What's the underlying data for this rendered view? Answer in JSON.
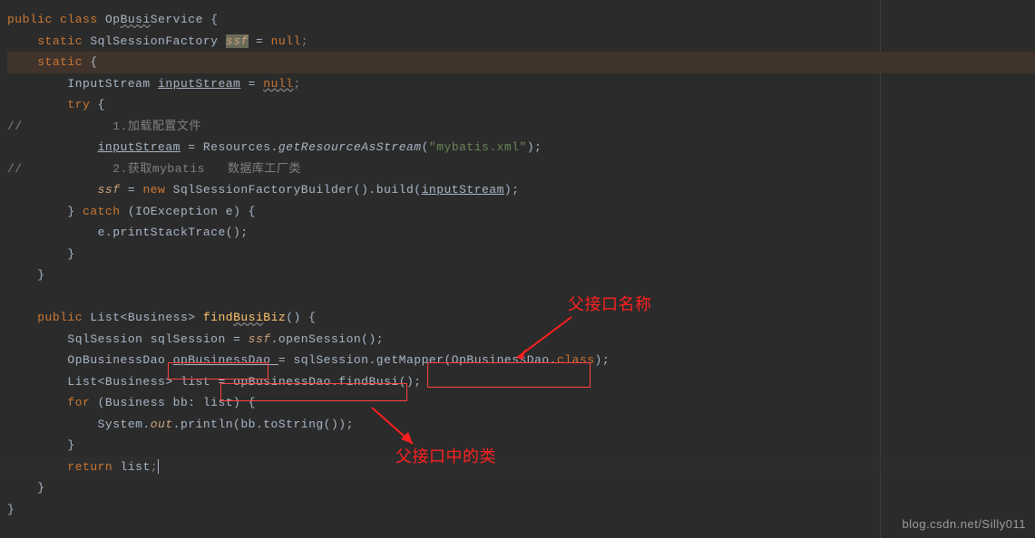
{
  "code": {
    "l1_public": "public",
    "l1_class": "class",
    "l1_name1": "Op",
    "l1_name2": "Busi",
    "l1_name3": "Service",
    "l1_brace": " {",
    "l2_static": "static",
    "l2_type": " SqlSessionFactory ",
    "l2_var": "ssf",
    "l2_eq": " = ",
    "l2_null": "null",
    "l2_semi": ";",
    "l3_static": "static",
    "l3_brace": " {",
    "l4_type": "InputStream ",
    "l4_var": "inputStream",
    "l4_eq": " = ",
    "l4_null": "null",
    "l4_semi": ";",
    "l5_try": "try",
    "l5_brace": " {",
    "l6": "//            1.加载配置文件",
    "l7_var": "inputStream",
    "l7_eq": " = Resources.",
    "l7_method": "getResourceAsStream",
    "l7_paren": "(",
    "l7_str": "\"mybatis.xml\"",
    "l7_end": ");",
    "l8": "//            2.获取mybatis   数据库工厂类",
    "l9_var": "ssf",
    "l9_eq": " = ",
    "l9_new": "new",
    "l9_type": " SqlSessionFactoryBuilder().build(",
    "l9_arg": "inputStream",
    "l9_end": ");",
    "l10_brace": "} ",
    "l10_catch": "catch",
    "l10_paren": " (IOException e) {",
    "l11": "e.printStackTrace();",
    "l12": "}",
    "l13": "}",
    "l15_public": "public",
    "l15_type": " List<Business> ",
    "l15_method": "find",
    "l15_method2": "Busi",
    "l15_method3": "Biz",
    "l15_end": "() {",
    "l16_type": "SqlSession sqlSession = ",
    "l16_var": "ssf",
    "l16_end": ".openSession();",
    "l17_pre": "OpBusinessDao ",
    "l17_var": "opBusinessDao ",
    "l17_eq": "= sqlSession.getMapper(",
    "l17_arg": "OpBusinessDao.",
    "l17_class": "class",
    "l17_end": ");",
    "l18_pre": "List<Business> list = ",
    "l18_var": "opBusinessDao.",
    "l18_method": "findBusi",
    "l18_end": "();",
    "l19_for": "for",
    "l19_paren": " (Business bb: list) {",
    "l20_pre": "System.",
    "l20_out": "out",
    "l20_end": ".println(bb.toString());",
    "l21": "}",
    "l22_return": "return",
    "l22_end": " list",
    "l22_semi": ";",
    "l23": "}",
    "l24": "}"
  },
  "annotations": {
    "parent_interface_name": "父接口名称",
    "parent_interface_class": "父接口中的类"
  },
  "watermark": "blog.csdn.net/Silly011"
}
